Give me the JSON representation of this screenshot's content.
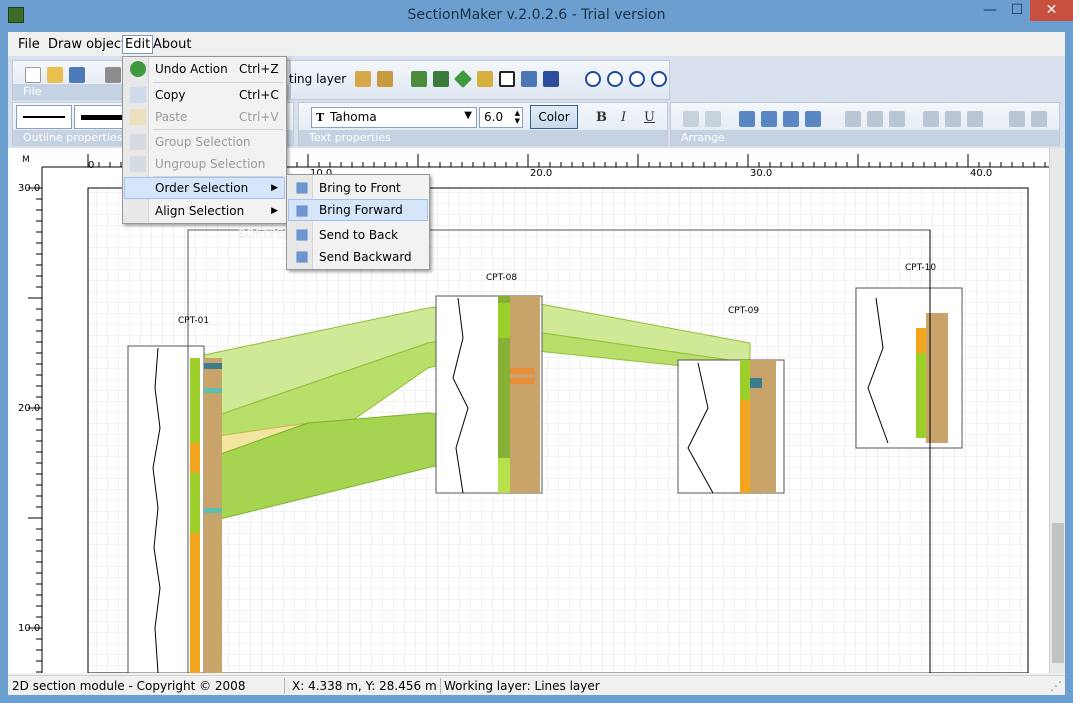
{
  "window": {
    "title": "SectionMaker v.2.0.2.6 - Trial version",
    "minimize": "—",
    "maximize": "☐",
    "close": "✕"
  },
  "menu": {
    "file": "File",
    "draw": "Draw objects",
    "edit": "Edit",
    "about": "About"
  },
  "toolbar": {
    "file_group": "File",
    "outline_group": "Outline properties",
    "text_group": "Text properties",
    "arrange_group": "Arrange",
    "working_layer_fragment": "ting layer",
    "font": "Tahoma",
    "font_size": "6.0",
    "color_label": "Color",
    "bold": "B",
    "italic": "I",
    "underline": "U"
  },
  "edit_menu": {
    "items": [
      {
        "label": "Undo Action",
        "shortcut": "Ctrl+Z",
        "enabled": true
      },
      {
        "label": "Copy",
        "shortcut": "Ctrl+C",
        "enabled": true
      },
      {
        "label": "Paste",
        "shortcut": "Ctrl+V",
        "enabled": false
      },
      {
        "label": "Group Selection",
        "shortcut": "",
        "enabled": false
      },
      {
        "label": "Ungroup Selection",
        "shortcut": "",
        "enabled": false
      },
      {
        "label": "Order Selection",
        "shortcut": "",
        "enabled": true,
        "highlighted": true
      },
      {
        "label": "Align Selection",
        "shortcut": "",
        "enabled": true
      }
    ]
  },
  "order_submenu": {
    "items": [
      {
        "label": "Bring to Front"
      },
      {
        "label": "Bring Forward",
        "highlighted": true
      },
      {
        "label": "Send to Back"
      },
      {
        "label": "Send Backward"
      }
    ]
  },
  "ruler": {
    "unit": "M",
    "x_labels": [
      "0",
      "10.0",
      "20.0",
      "30.0",
      "40.0"
    ],
    "y_labels": [
      "30.0",
      "20.0",
      "10.0"
    ]
  },
  "section": {
    "cpts": [
      {
        "name": "CPT-01"
      },
      {
        "name": "CPT-08"
      },
      {
        "name": "CPT-09"
      },
      {
        "name": "CPT-10"
      }
    ],
    "watermark": "SOFTPEDIA"
  },
  "status": {
    "module": "2D section module - Copyright © 2008",
    "coords": "X: 4.338 m, Y: 28.456 m",
    "layer": "Working layer: Lines layer"
  }
}
